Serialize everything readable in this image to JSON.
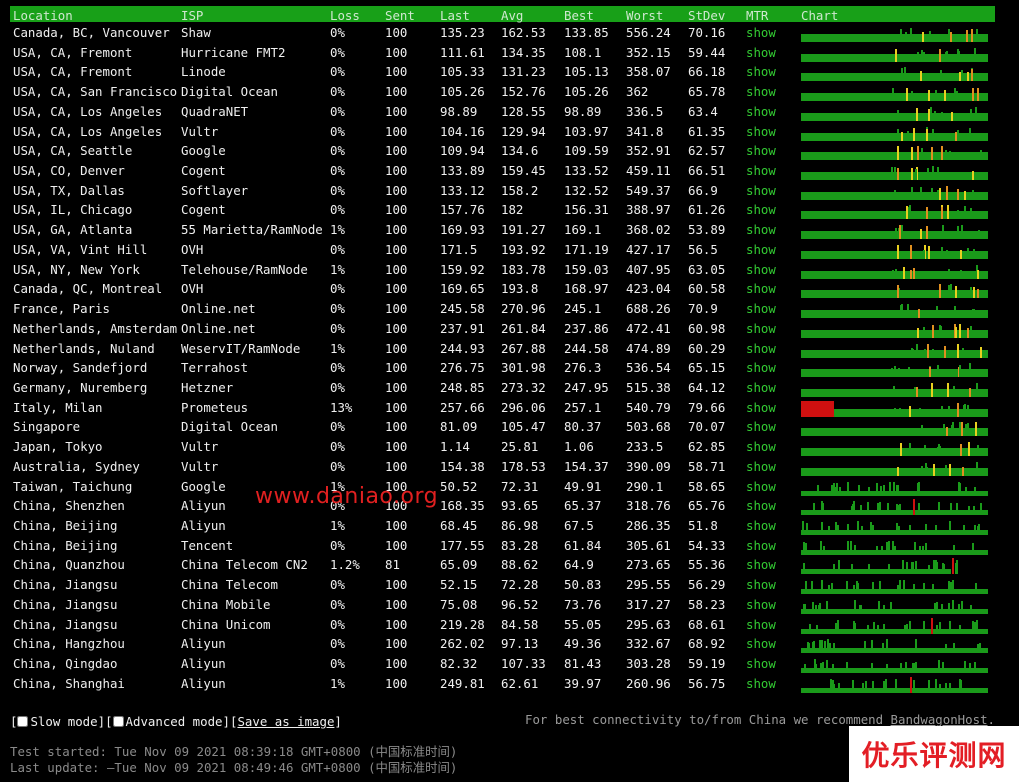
{
  "columns": [
    "Location",
    "ISP",
    "Loss",
    "Sent",
    "Last",
    "Avg",
    "Best",
    "Worst",
    "StDev",
    "MTR",
    "Chart"
  ],
  "rows": [
    {
      "location": "Canada, BC, Vancouver",
      "isp": "Shaw",
      "loss": "0%",
      "sent": "100",
      "last": "135.23",
      "avg": "162.53",
      "best": "133.85",
      "worst": "556.24",
      "stdev": "70.16",
      "mtr": "show"
    },
    {
      "location": "USA, CA, Fremont",
      "isp": "Hurricane FMT2",
      "loss": "0%",
      "sent": "100",
      "last": "111.61",
      "avg": "134.35",
      "best": "108.1",
      "worst": "352.15",
      "stdev": "59.44",
      "mtr": "show"
    },
    {
      "location": "USA, CA, Fremont",
      "isp": "Linode",
      "loss": "0%",
      "sent": "100",
      "last": "105.33",
      "avg": "131.23",
      "best": "105.13",
      "worst": "358.07",
      "stdev": "66.18",
      "mtr": "show"
    },
    {
      "location": "USA, CA, San Francisco",
      "isp": "Digital Ocean",
      "loss": "0%",
      "sent": "100",
      "last": "105.26",
      "avg": "152.76",
      "best": "105.26",
      "worst": "362",
      "stdev": "65.78",
      "mtr": "show"
    },
    {
      "location": "USA, CA, Los Angeles",
      "isp": "QuadraNET",
      "loss": "0%",
      "sent": "100",
      "last": "98.89",
      "avg": "128.55",
      "best": "98.89",
      "worst": "336.5",
      "stdev": "63.4",
      "mtr": "show"
    },
    {
      "location": "USA, CA, Los Angeles",
      "isp": "Vultr",
      "loss": "0%",
      "sent": "100",
      "last": "104.16",
      "avg": "129.94",
      "best": "103.97",
      "worst": "341.8",
      "stdev": "61.35",
      "mtr": "show"
    },
    {
      "location": "USA, CA, Seattle",
      "isp": "Google",
      "loss": "0%",
      "sent": "100",
      "last": "109.94",
      "avg": "134.6",
      "best": "109.59",
      "worst": "352.91",
      "stdev": "62.57",
      "mtr": "show"
    },
    {
      "location": "USA, CO, Denver",
      "isp": "Cogent",
      "loss": "0%",
      "sent": "100",
      "last": "133.89",
      "avg": "159.45",
      "best": "133.52",
      "worst": "459.11",
      "stdev": "66.51",
      "mtr": "show"
    },
    {
      "location": "USA, TX, Dallas",
      "isp": "Softlayer",
      "loss": "0%",
      "sent": "100",
      "last": "133.12",
      "avg": "158.2",
      "best": "132.52",
      "worst": "549.37",
      "stdev": "66.9",
      "mtr": "show"
    },
    {
      "location": "USA, IL, Chicago",
      "isp": "Cogent",
      "loss": "0%",
      "sent": "100",
      "last": "157.76",
      "avg": "182",
      "best": "156.31",
      "worst": "388.97",
      "stdev": "61.26",
      "mtr": "show"
    },
    {
      "location": "USA, GA, Atlanta",
      "isp": "55 Marietta/RamNode",
      "loss": "1%",
      "sent": "100",
      "last": "169.93",
      "avg": "191.27",
      "best": "169.1",
      "worst": "368.02",
      "stdev": "53.89",
      "mtr": "show"
    },
    {
      "location": "USA, VA, Vint Hill",
      "isp": "OVH",
      "loss": "0%",
      "sent": "100",
      "last": "171.5",
      "avg": "193.92",
      "best": "171.19",
      "worst": "427.17",
      "stdev": "56.5",
      "mtr": "show"
    },
    {
      "location": "USA, NY, New York",
      "isp": "Telehouse/RamNode",
      "loss": "1%",
      "sent": "100",
      "last": "159.92",
      "avg": "183.78",
      "best": "159.03",
      "worst": "407.95",
      "stdev": "63.05",
      "mtr": "show"
    },
    {
      "location": "Canada, QC, Montreal",
      "isp": "OVH",
      "loss": "0%",
      "sent": "100",
      "last": "169.65",
      "avg": "193.8",
      "best": "168.97",
      "worst": "423.04",
      "stdev": "60.58",
      "mtr": "show"
    },
    {
      "location": "France, Paris",
      "isp": "Online.net",
      "loss": "0%",
      "sent": "100",
      "last": "245.58",
      "avg": "270.96",
      "best": "245.1",
      "worst": "688.26",
      "stdev": "70.9",
      "mtr": "show"
    },
    {
      "location": "Netherlands, Amsterdam",
      "isp": "Online.net",
      "loss": "0%",
      "sent": "100",
      "last": "237.91",
      "avg": "261.84",
      "best": "237.86",
      "worst": "472.41",
      "stdev": "60.98",
      "mtr": "show"
    },
    {
      "location": "Netherlands, Nuland",
      "isp": "WeservIT/RamNode",
      "loss": "1%",
      "sent": "100",
      "last": "244.93",
      "avg": "267.88",
      "best": "244.58",
      "worst": "474.89",
      "stdev": "60.29",
      "mtr": "show"
    },
    {
      "location": "Norway, Sandefjord",
      "isp": "Terrahost",
      "loss": "0%",
      "sent": "100",
      "last": "276.75",
      "avg": "301.98",
      "best": "276.3",
      "worst": "536.54",
      "stdev": "65.15",
      "mtr": "show"
    },
    {
      "location": "Germany, Nuremberg",
      "isp": "Hetzner",
      "loss": "0%",
      "sent": "100",
      "last": "248.85",
      "avg": "273.32",
      "best": "247.95",
      "worst": "515.38",
      "stdev": "64.12",
      "mtr": "show"
    },
    {
      "location": "Italy, Milan",
      "isp": "Prometeus",
      "loss": "13%",
      "sent": "100",
      "last": "257.66",
      "avg": "296.06",
      "best": "257.1",
      "worst": "540.79",
      "stdev": "79.66",
      "mtr": "show"
    },
    {
      "location": "Singapore",
      "isp": "Digital Ocean",
      "loss": "0%",
      "sent": "100",
      "last": "81.09",
      "avg": "105.47",
      "best": "80.37",
      "worst": "503.68",
      "stdev": "70.07",
      "mtr": "show"
    },
    {
      "location": "Japan, Tokyo",
      "isp": "Vultr",
      "loss": "0%",
      "sent": "100",
      "last": "1.14",
      "avg": "25.81",
      "best": "1.06",
      "worst": "233.5",
      "stdev": "62.85",
      "mtr": "show"
    },
    {
      "location": "Australia, Sydney",
      "isp": "Vultr",
      "loss": "0%",
      "sent": "100",
      "last": "154.38",
      "avg": "178.53",
      "best": "154.37",
      "worst": "390.09",
      "stdev": "58.71",
      "mtr": "show"
    },
    {
      "location": "Taiwan, Taichung",
      "isp": "Google",
      "loss": "1%",
      "sent": "100",
      "last": "50.52",
      "avg": "72.31",
      "best": "49.91",
      "worst": "290.1",
      "stdev": "58.65",
      "mtr": "show"
    },
    {
      "location": "China, Shenzhen",
      "isp": "Aliyun",
      "loss": "0%",
      "sent": "100",
      "last": "168.35",
      "avg": "93.65",
      "best": "65.37",
      "worst": "318.76",
      "stdev": "65.76",
      "mtr": "show"
    },
    {
      "location": "China, Beijing",
      "isp": "Aliyun",
      "loss": "1%",
      "sent": "100",
      "last": "68.45",
      "avg": "86.98",
      "best": "67.5",
      "worst": "286.35",
      "stdev": "51.8",
      "mtr": "show"
    },
    {
      "location": "China, Beijing",
      "isp": "Tencent",
      "loss": "0%",
      "sent": "100",
      "last": "177.55",
      "avg": "83.28",
      "best": "61.84",
      "worst": "305.61",
      "stdev": "54.33",
      "mtr": "show"
    },
    {
      "location": "China, Quanzhou",
      "isp": "China Telecom CN2",
      "loss": "1.2%",
      "sent": "81",
      "last": "65.09",
      "avg": "88.62",
      "best": "64.9",
      "worst": "273.65",
      "stdev": "55.36",
      "mtr": "show"
    },
    {
      "location": "China, Jiangsu",
      "isp": "China Telecom",
      "loss": "0%",
      "sent": "100",
      "last": "52.15",
      "avg": "72.28",
      "best": "50.83",
      "worst": "295.55",
      "stdev": "56.29",
      "mtr": "show"
    },
    {
      "location": "China, Jiangsu",
      "isp": "China Mobile",
      "loss": "0%",
      "sent": "100",
      "last": "75.08",
      "avg": "96.52",
      "best": "73.76",
      "worst": "317.27",
      "stdev": "58.23",
      "mtr": "show"
    },
    {
      "location": "China, Jiangsu",
      "isp": "China Unicom",
      "loss": "0%",
      "sent": "100",
      "last": "219.28",
      "avg": "84.58",
      "best": "55.05",
      "worst": "295.63",
      "stdev": "68.61",
      "mtr": "show"
    },
    {
      "location": "China, Hangzhou",
      "isp": "Aliyun",
      "loss": "0%",
      "sent": "100",
      "last": "262.02",
      "avg": "97.13",
      "best": "49.36",
      "worst": "332.67",
      "stdev": "68.92",
      "mtr": "show"
    },
    {
      "location": "China, Qingdao",
      "isp": "Aliyun",
      "loss": "0%",
      "sent": "100",
      "last": "82.32",
      "avg": "107.33",
      "best": "81.43",
      "worst": "303.28",
      "stdev": "59.19",
      "mtr": "show"
    },
    {
      "location": "China, Shanghai",
      "isp": "Aliyun",
      "loss": "1%",
      "sent": "100",
      "last": "249.81",
      "avg": "62.61",
      "best": "39.97",
      "worst": "260.96",
      "stdev": "56.75",
      "mtr": "show"
    }
  ],
  "options": {
    "slow_mode": "Slow mode",
    "advanced_mode": "Advanced mode",
    "save_image": "Save as image"
  },
  "recommend": {
    "text": "For best connectivity to/from China we recommend ",
    "brand": "BandwagonHost",
    "suffix": "."
  },
  "times": {
    "started": "Test started: Tue Nov 09 2021 08:39:18 GMT+0800 (中国标准时间)",
    "updated": "Last update: —Tue Nov 09 2021 08:49:46 GMT+0800 (中国标准时间)"
  },
  "watermarks": {
    "center": "www.daniao.org",
    "corner": "优乐评测网"
  },
  "colors": {
    "header_bg": "#18a018",
    "chart_base": "#1a9a1a",
    "spike_yellow": "#e8d020",
    "spike_orange": "#e09020",
    "spike_red": "#d01010",
    "mtr_link": "#33cc33"
  }
}
